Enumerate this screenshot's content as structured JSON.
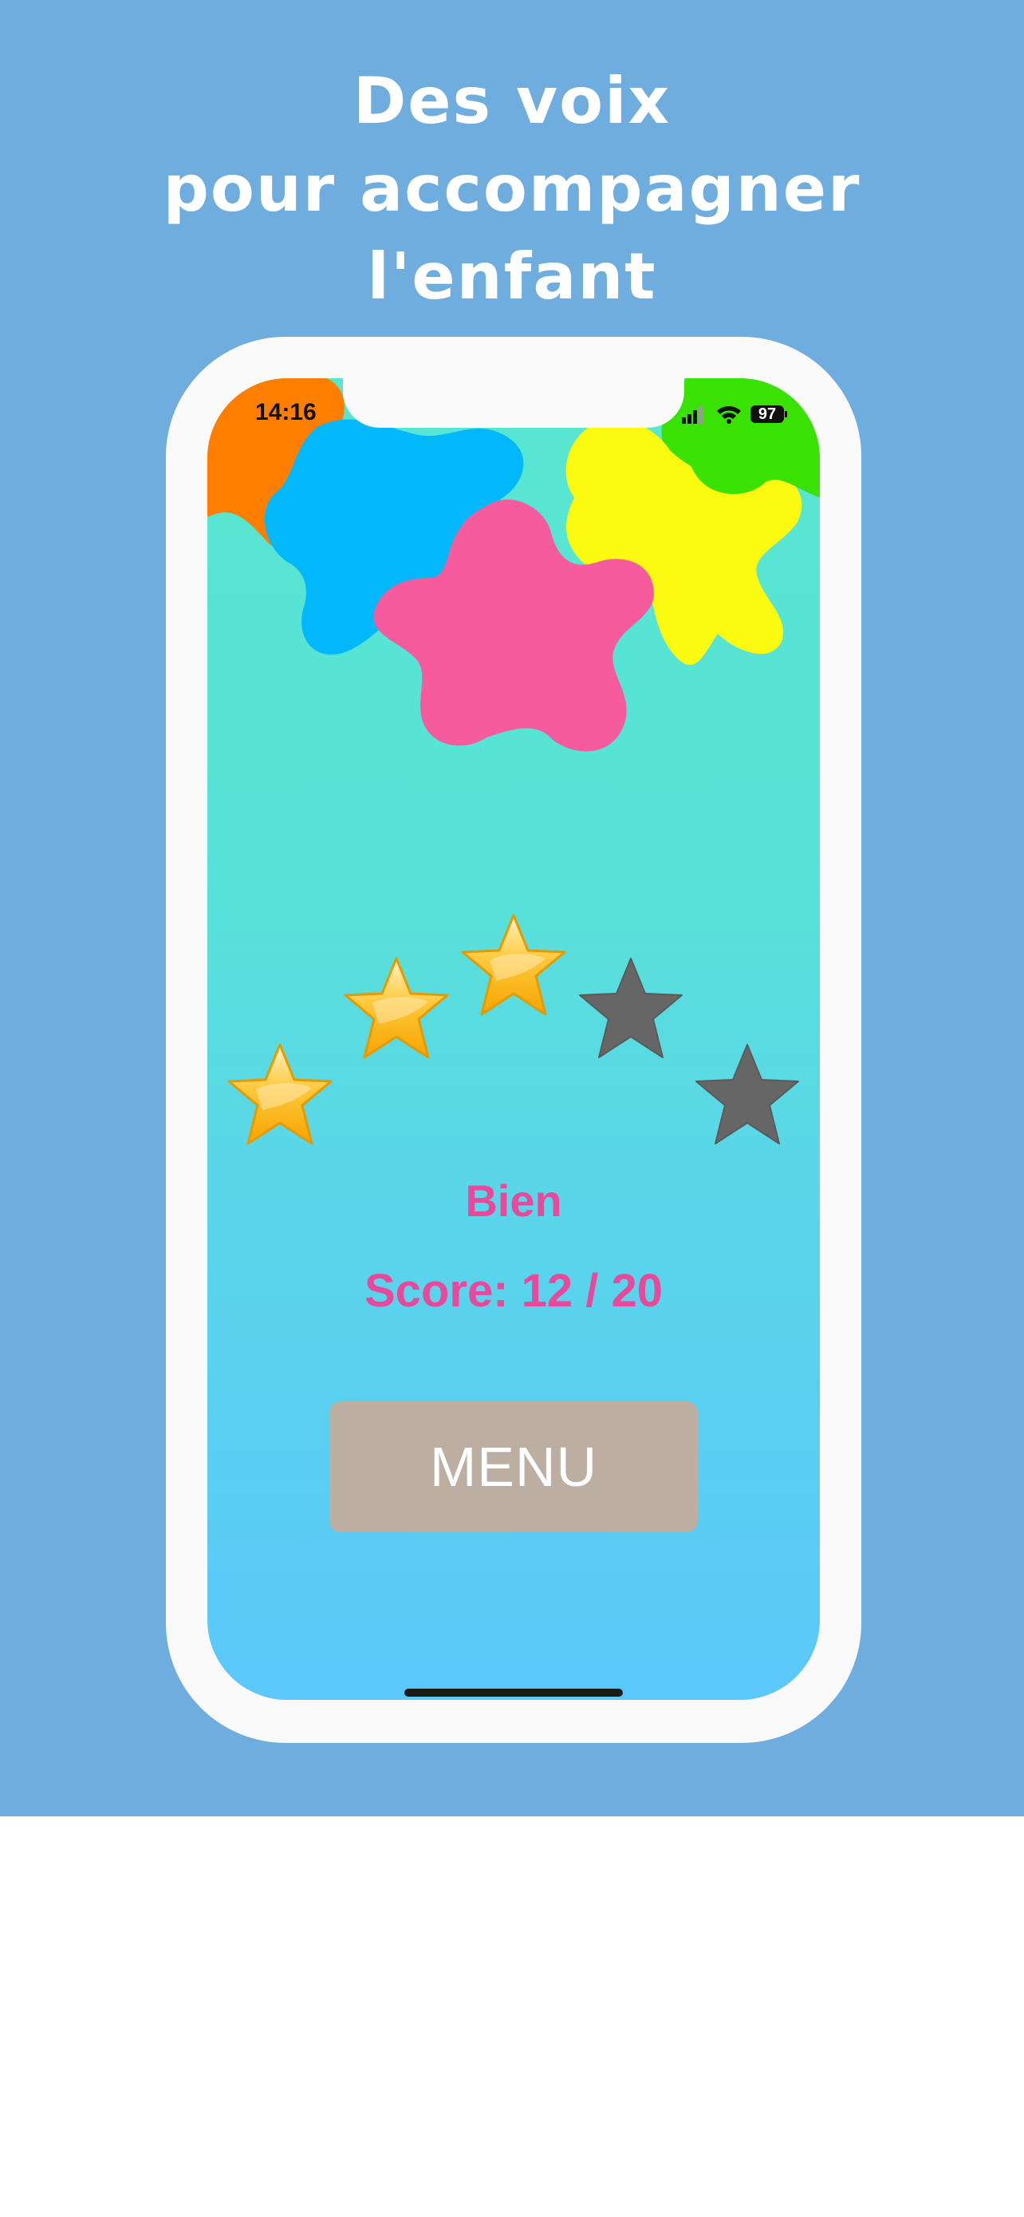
{
  "headline": {
    "line1": "Des voix",
    "line2": "pour accompagner",
    "line3": "l'enfant"
  },
  "colors": {
    "promo_background": "#6faddf",
    "phone_frame": "#fafafa",
    "text_accent": "#e8499b",
    "menu_button": "#bcaea1",
    "splat_orange": "#fe7f00",
    "splat_green": "#3ae203",
    "splat_yellow": "#fcfa11",
    "splat_blue": "#03b7fb",
    "splat_pink": "#f55b9d",
    "star_gold": "#ffb400",
    "star_empty": "#666666"
  },
  "status_bar": {
    "time": "14:16",
    "battery": "97",
    "icons": [
      "signal-icon",
      "wifi-icon",
      "battery-icon"
    ]
  },
  "result": {
    "stars_earned": 3,
    "stars_total": 5,
    "rating_label": "Bien",
    "score_text": "Score: 12 / 20"
  },
  "menu_button": {
    "label": "MENU"
  }
}
